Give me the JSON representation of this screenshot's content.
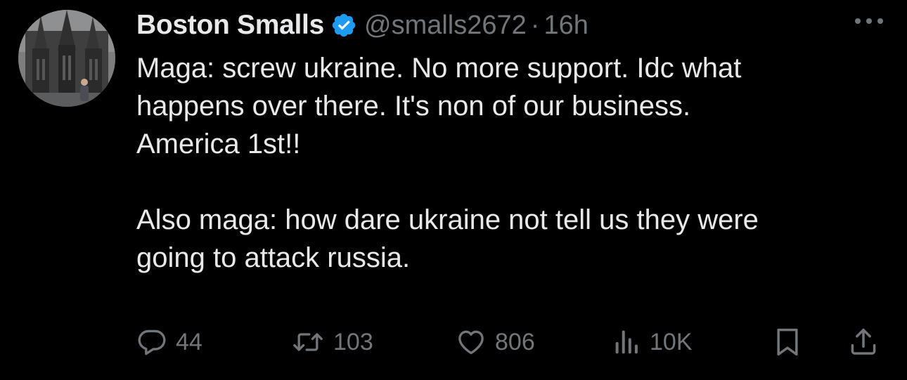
{
  "tweet": {
    "author": {
      "display_name": "Boston Smalls",
      "handle": "@smalls2672",
      "verified": true,
      "avatar": "profile-photo-cathedral"
    },
    "separator": "·",
    "time": "16h",
    "more_icon": "more-horizontal-icon",
    "text": {
      "paragraph1": "Maga: screw ukraine. No more support. Idc what\nhappens over there. It's non of our business.\nAmerica 1st!!",
      "paragraph2": "Also maga: how dare ukraine not tell us they were\ngoing to attack russia."
    },
    "actions": {
      "replies": {
        "icon": "reply-icon",
        "count": "44"
      },
      "retweets": {
        "icon": "retweet-icon",
        "count": "103"
      },
      "likes": {
        "icon": "heart-icon",
        "count": "806"
      },
      "views": {
        "icon": "views-icon",
        "count": "10K"
      },
      "bookmark": {
        "icon": "bookmark-icon"
      },
      "share": {
        "icon": "share-icon"
      }
    }
  },
  "colors": {
    "background": "#000000",
    "primary_text": "#e7e9ea",
    "secondary_text": "#71767b",
    "verified_blue": "#1d9bf0"
  }
}
